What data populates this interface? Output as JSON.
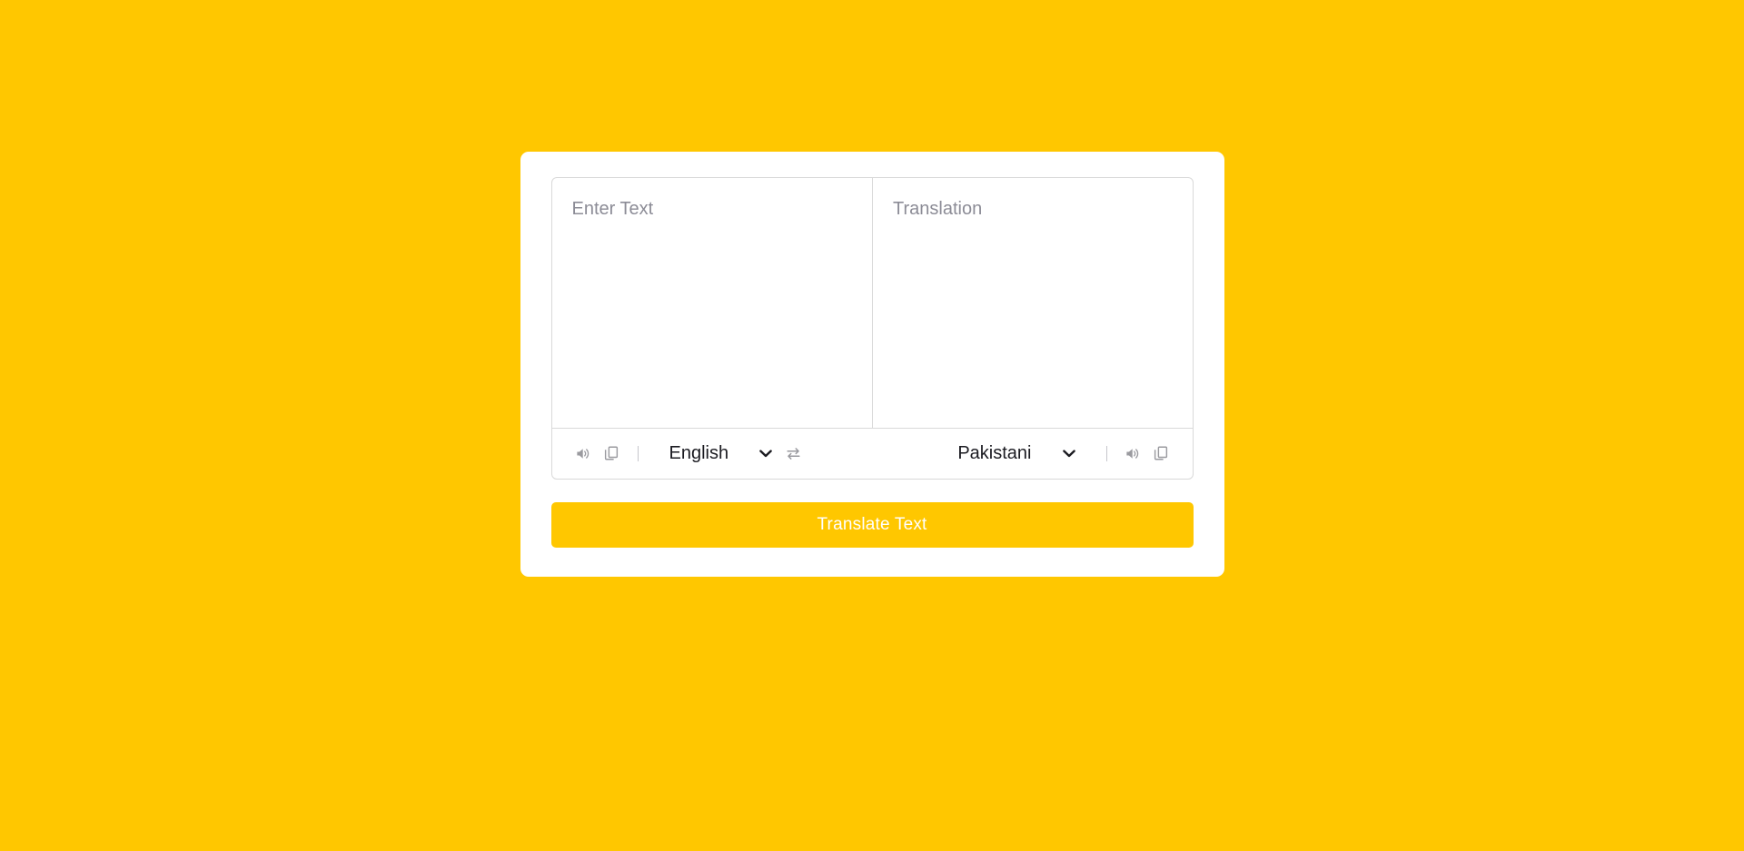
{
  "theme": {
    "background_color": "#FFC700",
    "card_color": "#FFFFFF",
    "accent_color": "#FFC700",
    "border_color": "#D9D9D9",
    "placeholder_color": "#8C8C96",
    "icon_color": "#9A9A9F",
    "text_color": "#1B1B21",
    "button_text_color": "#FFFFFF"
  },
  "translator": {
    "source": {
      "placeholder": "Enter Text",
      "value": "",
      "speak_icon": "volume-icon",
      "copy_icon": "copy-icon",
      "language": "English",
      "dropdown_icon": "chevron-down-icon"
    },
    "swap": {
      "icon": "swap-horizontal-icon"
    },
    "target": {
      "placeholder": "Translation",
      "value": "",
      "speak_icon": "volume-icon",
      "copy_icon": "copy-icon",
      "language": "Pakistani",
      "dropdown_icon": "chevron-down-icon"
    },
    "translate_button_label": "Translate Text"
  }
}
